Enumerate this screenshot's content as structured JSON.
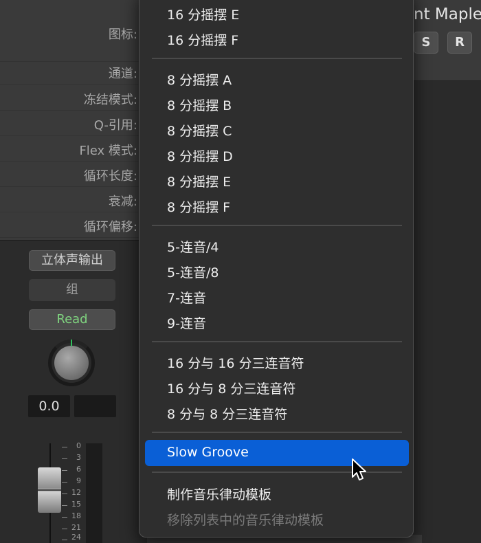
{
  "inspector": {
    "labels": [
      "图标:",
      "通道:",
      "冻结模式:",
      "Q-引用:",
      "Flex 模式:",
      "循环长度:",
      "衰减:",
      "循环偏移:"
    ]
  },
  "strip": {
    "output_label": "立体声输出",
    "group_label": "组",
    "automation_label": "Read",
    "pan_value": "0.0",
    "scale_labels": [
      "0",
      "3",
      "6",
      "9",
      "12",
      "15",
      "18",
      "21",
      "24"
    ]
  },
  "track_header": {
    "name_fragment": "nt Maple",
    "solo_label": "S",
    "record_label": "R"
  },
  "menu": {
    "group1": [
      "16 分摇摆 E",
      "16 分摇摆 F"
    ],
    "group2": [
      "8 分摇摆 A",
      "8 分摇摆 B",
      "8 分摇摆 C",
      "8 分摇摆 D",
      "8 分摇摆 E",
      "8 分摇摆 F"
    ],
    "group3": [
      "5-连音/4",
      "5-连音/8",
      "7-连音",
      "9-连音"
    ],
    "group4": [
      "16 分与 16 分三连音符",
      "16 分与 8 分三连音符",
      "8 分与 8 分三连音符"
    ],
    "selected": "Slow Groove",
    "make_template": "制作音乐律动模板",
    "remove_template": "移除列表中的音乐律动模板"
  },
  "colors": {
    "highlight": "#0a5fd6",
    "read_green": "#7fd37f"
  }
}
